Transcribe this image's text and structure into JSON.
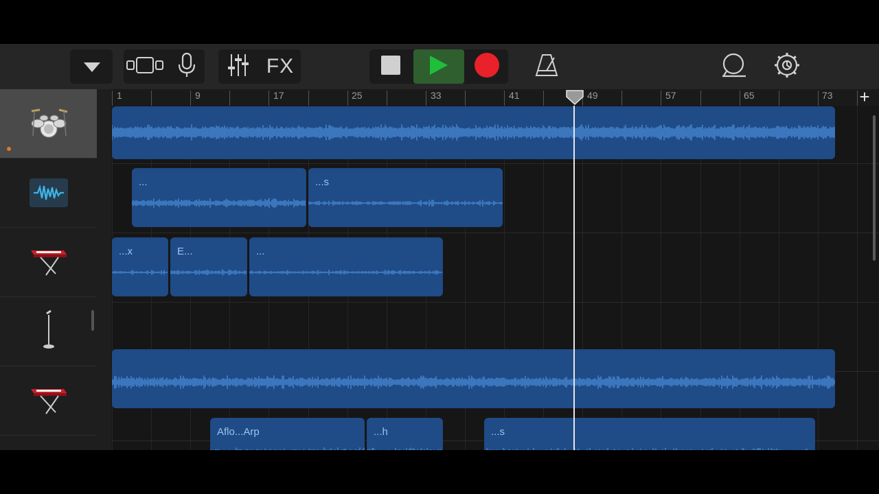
{
  "toolbar": {
    "tracks_menu_icon": "triangle-down-icon",
    "view_icon": "tracks-view-icon",
    "mic_icon": "microphone-icon",
    "mixer_icon": "mixer-sliders-icon",
    "fx_label": "FX",
    "stop_icon": "stop-icon",
    "play_icon": "play-icon",
    "record_icon": "record-icon",
    "metronome_icon": "metronome-icon",
    "loop_icon": "loop-browser-icon",
    "settings_icon": "gear-icon"
  },
  "ruler": {
    "bars": [
      "1",
      "9",
      "17",
      "25",
      "33",
      "41",
      "49",
      "57",
      "65",
      "73"
    ],
    "add_label": "+"
  },
  "tracks": [
    {
      "instrument": "drums-icon",
      "selected": true
    },
    {
      "instrument": "audio-recorder-icon",
      "selected": false
    },
    {
      "instrument": "keyboard-icon",
      "selected": false
    },
    {
      "instrument": "microphone-stand-icon",
      "selected": false
    },
    {
      "instrument": "keyboard-icon",
      "selected": false
    }
  ],
  "regions": {
    "r1": {
      "label": ""
    },
    "r2": {
      "label": "..."
    },
    "r3": {
      "label": "...s"
    },
    "r4": {
      "label": "...x"
    },
    "r5": {
      "label": "E..."
    },
    "r6": {
      "label": "..."
    },
    "r7": {
      "label": ""
    },
    "r8": {
      "label": "Aflo...Arp"
    },
    "r9": {
      "label": "...h"
    },
    "r10": {
      "label": "...s"
    }
  },
  "colors": {
    "region": "#1f4b87",
    "waveform": "#4f93e0",
    "play": "#1fbf3a",
    "record": "#e8212a",
    "playhead": "#e8e8e8"
  }
}
